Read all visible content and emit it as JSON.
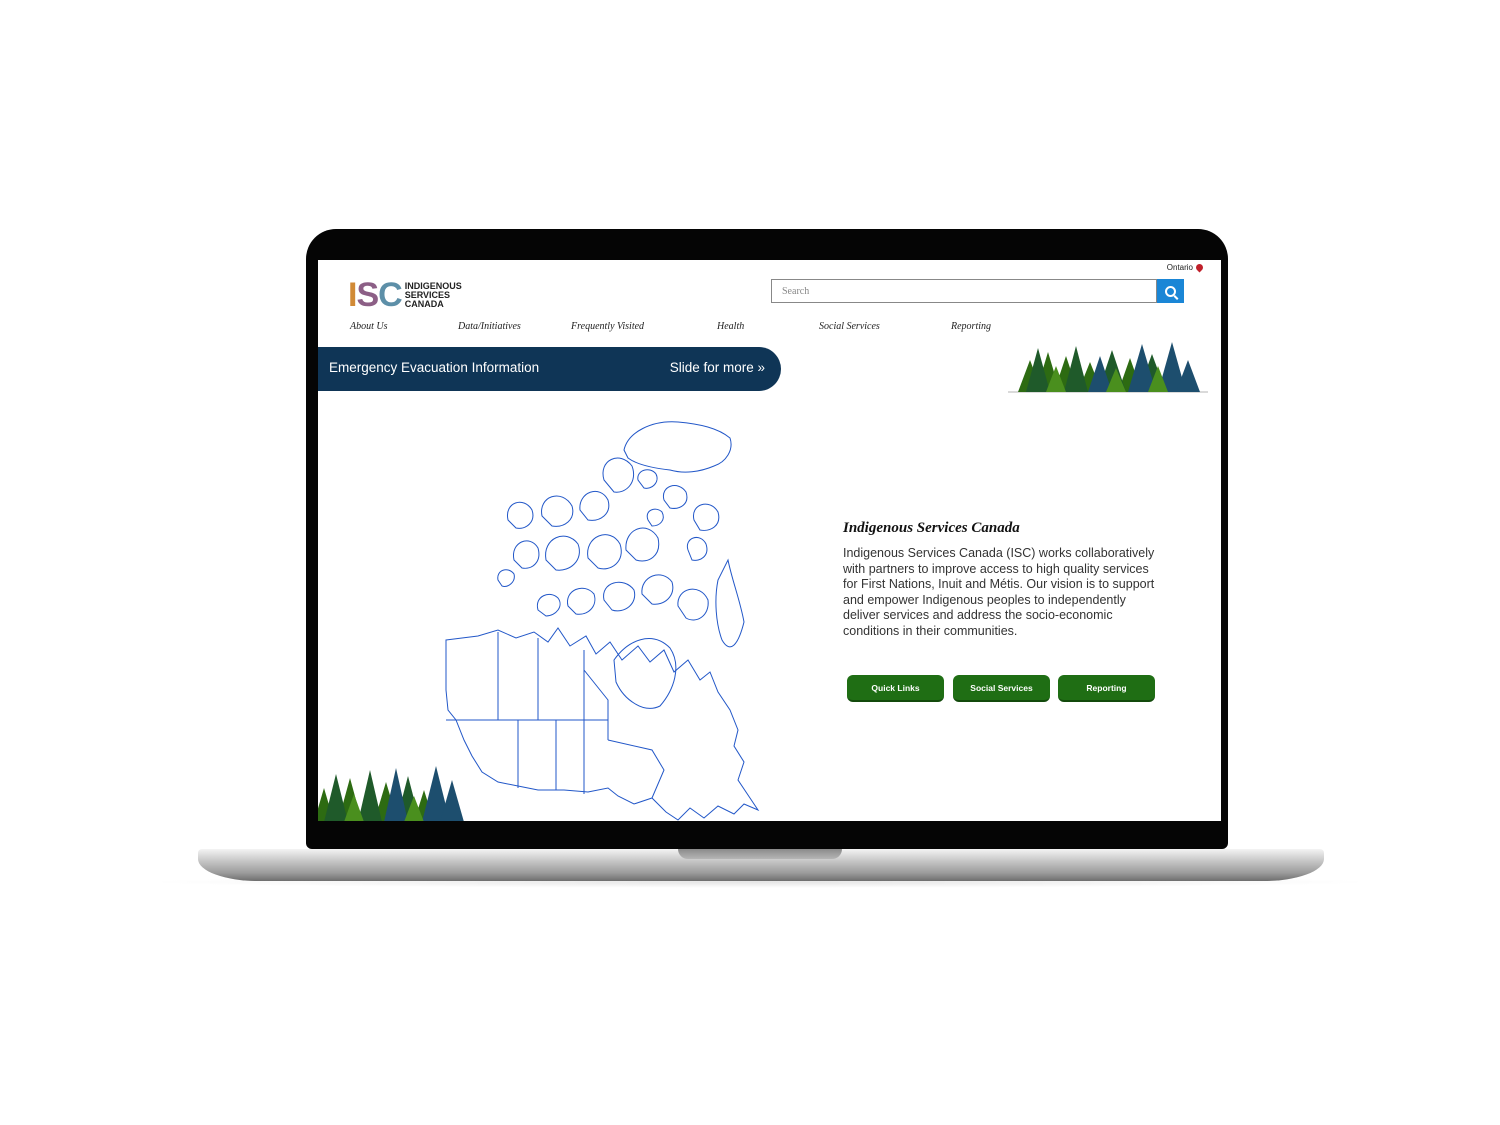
{
  "header": {
    "region": "Ontario",
    "logo": {
      "initials_1": "I",
      "initials_2": "S",
      "initials_3": "C",
      "line1": "INDIGENOUS",
      "line2": "SERVICES",
      "line3": "CANADA"
    },
    "search": {
      "placeholder": "Search"
    }
  },
  "nav": {
    "items": [
      "About Us",
      "Data/Initiatives",
      "Frequently Visited",
      "Health",
      "Social Services",
      "Reporting"
    ]
  },
  "banner": {
    "text": "Emergency Evacuation Information",
    "action": "Slide for more »"
  },
  "main": {
    "title": "Indigenous Services Canada",
    "description": "Indigenous Services Canada (ISC) works collaboratively with partners to improve access to high quality services for First Nations, Inuit and Métis. Our vision is to support and empower Indigenous peoples to independently deliver services and address the socio-economic conditions in their communities.",
    "buttons": [
      "Quick Links",
      "Social Services",
      "Reporting"
    ]
  },
  "colors": {
    "banner": "#0f3556",
    "button": "#1f6e14",
    "search_button": "#1a86d6",
    "map_stroke": "#2257c8"
  }
}
